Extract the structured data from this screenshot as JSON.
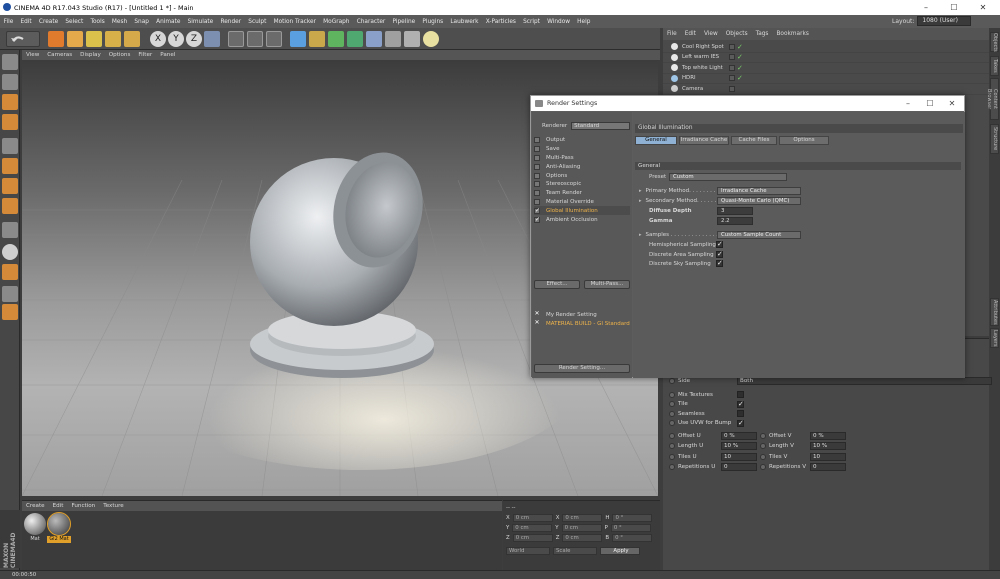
{
  "titlebar": {
    "title": "CINEMA 4D R17.043 Studio (R17) - [Untitled 1 *] - Main",
    "min": "–",
    "max": "☐",
    "close": "✕"
  },
  "menu": [
    "File",
    "Edit",
    "Create",
    "Select",
    "Tools",
    "Mesh",
    "Snap",
    "Animate",
    "Simulate",
    "Render",
    "Sculpt",
    "Motion Tracker",
    "MoGraph",
    "Character",
    "Pipeline",
    "Plugins",
    "Laubwerk",
    "X-Particles",
    "Script",
    "Window",
    "Help"
  ],
  "layout": {
    "label": "Layout:",
    "value": "1080 (User)"
  },
  "viewport_menu": [
    "View",
    "Cameras",
    "Display",
    "Options",
    "Filter",
    "Panel"
  ],
  "material_menu": [
    "Create",
    "Edit",
    "Function",
    "Texture"
  ],
  "materials": [
    {
      "label": "Mat"
    },
    {
      "label": "Gi2 Mat"
    }
  ],
  "coords": {
    "header": "--  --",
    "rows": [
      {
        "a": "X",
        "av": "0 cm",
        "b": "X",
        "bv": "0 cm",
        "c": "H",
        "cv": "0 °"
      },
      {
        "a": "Y",
        "av": "0 cm",
        "b": "Y",
        "bv": "0 cm",
        "c": "P",
        "cv": "0 °"
      },
      {
        "a": "Z",
        "av": "0 cm",
        "b": "Z",
        "bv": "0 cm",
        "c": "B",
        "cv": "0 °"
      }
    ],
    "mode1": "World",
    "mode2": "Scale",
    "apply": "Apply"
  },
  "status": {
    "time": "00:00:50"
  },
  "maxon": "MAXON CINEMA4D",
  "object_menu": [
    "File",
    "Edit",
    "View",
    "Objects",
    "Tags",
    "Bookmarks"
  ],
  "objects": [
    "Cool Right Spot",
    "Left warm IES",
    "Top white Light",
    "HDRI",
    "Camera"
  ],
  "side_tabs": [
    "Objects",
    "Takes",
    "Content Browser",
    "Structure",
    "Attributes",
    "Layers"
  ],
  "attributes": {
    "side_label": "Side",
    "side_value": "Both",
    "checks": [
      {
        "label": "Mix Textures",
        "checked": false
      },
      {
        "label": "Tile",
        "checked": true
      },
      {
        "label": "Seamless",
        "checked": false
      },
      {
        "label": "Use UVW for Bump",
        "checked": true
      }
    ],
    "fields": [
      {
        "l1": "Offset U",
        "v1": "0 %",
        "l2": "Offset V",
        "v2": "0 %"
      },
      {
        "l1": "Length U",
        "v1": "10 %",
        "l2": "Length V",
        "v2": "10 %"
      },
      {
        "l1": "Tiles U",
        "v1": "10",
        "l2": "Tiles V",
        "v2": "10"
      },
      {
        "l1": "Repetitions U",
        "v1": "0",
        "l2": "Repetitions V",
        "v2": "0"
      }
    ]
  },
  "render_settings": {
    "title": "Render Settings",
    "renderer_label": "Renderer",
    "renderer_value": "Standard",
    "items": [
      {
        "label": "Output",
        "check": "",
        "selected": false
      },
      {
        "label": "Save",
        "check": "",
        "selected": false
      },
      {
        "label": "Multi-Pass",
        "check": "",
        "selected": false
      },
      {
        "label": "Anti-Aliasing",
        "check": "",
        "selected": false
      },
      {
        "label": "Options",
        "check": "",
        "selected": false
      },
      {
        "label": "Stereoscopic",
        "check": "",
        "selected": false
      },
      {
        "label": "Team Render",
        "check": "",
        "selected": false
      },
      {
        "label": "Material Override",
        "check": "",
        "selected": false
      },
      {
        "label": "Global Illumination",
        "check": "✓",
        "selected": true
      },
      {
        "label": "Ambient Occlusion",
        "check": "✓",
        "selected": false
      }
    ],
    "effect_btn": "Effect...",
    "multipass_btn": "Multi-Pass...",
    "settings": [
      {
        "label": "My Render Setting",
        "active": false
      },
      {
        "label": "MATERIAL BUILD - GI Standard",
        "active": true
      }
    ],
    "rs_btn": "Render Setting...",
    "panel_title": "Global Illumination",
    "tabs": [
      "General",
      "Irradiance Cache",
      "Cache Files",
      "Options"
    ],
    "section": "General",
    "preset_label": "Preset",
    "preset_value": "Custom",
    "primary_label": "Primary Method. . . . . . . .",
    "primary_value": "Irradiance Cache",
    "secondary_label": "Secondary Method. . . . . .",
    "secondary_value": "Quasi-Monte Carlo (QMC)",
    "depth_label": "Diffuse Depth",
    "depth_value": "3",
    "gamma_label": "Gamma",
    "gamma_value": "2.2",
    "samples_label": "Samples . . . . . . . . . . . . . .",
    "samples_value": "Custom Sample Count",
    "hemi_label": "Hemispherical Sampling",
    "discrete_area_label": "Discrete Area Sampling",
    "discrete_sky_label": "Discrete Sky Sampling"
  },
  "colors": {
    "accent": "#8fb1d3",
    "selected_text": "#f0b44a",
    "check_green": "#7bd36a"
  }
}
